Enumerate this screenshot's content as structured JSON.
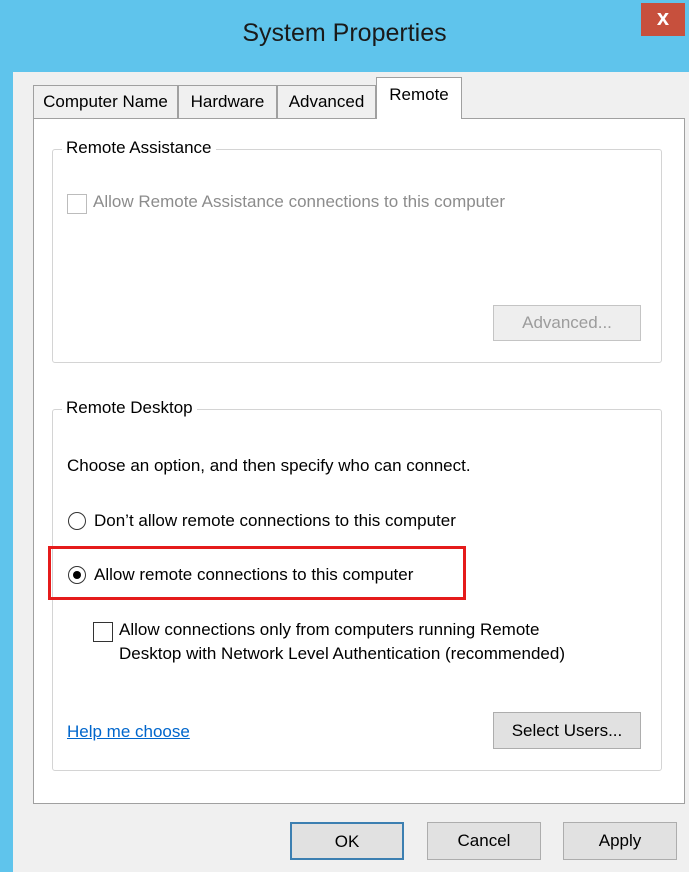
{
  "window": {
    "title": "System Properties",
    "close_label": "x"
  },
  "tabs": [
    {
      "label": "Computer Name",
      "active": false
    },
    {
      "label": "Hardware",
      "active": false
    },
    {
      "label": "Advanced",
      "active": false
    },
    {
      "label": "Remote",
      "active": true
    }
  ],
  "remote_assistance": {
    "group_label": "Remote Assistance",
    "allow_label": "Allow Remote Assistance connections to this computer",
    "allow_checked": false,
    "advanced_button": "Advanced..."
  },
  "remote_desktop": {
    "group_label": "Remote Desktop",
    "instruction": "Choose an option, and then specify who can connect.",
    "option_dont_allow": "Don’t allow remote connections to this computer",
    "option_allow": "Allow remote connections to this computer",
    "selected_option": "allow",
    "nla_label_line1": "Allow connections only from computers running Remote",
    "nla_label_line2": "Desktop with Network Level Authentication (recommended)",
    "nla_checked": false,
    "help_link": "Help me choose",
    "select_users_button": "Select Users..."
  },
  "footer": {
    "ok": "OK",
    "cancel": "Cancel",
    "apply": "Apply"
  },
  "colors": {
    "titlebar": "#5fc4ec",
    "close": "#c7503d",
    "highlight": "#e51b1b",
    "link": "#0066cc"
  }
}
